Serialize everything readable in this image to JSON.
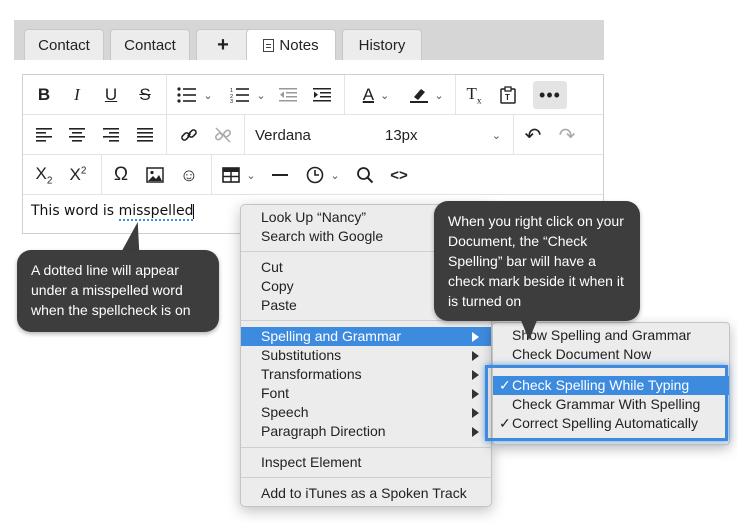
{
  "tabs": [
    {
      "label": "Contact"
    },
    {
      "label": "Contact"
    },
    {
      "label": "+"
    },
    {
      "label": "Notes"
    },
    {
      "label": "History"
    }
  ],
  "toolbar": {
    "row1": [
      "bold-icon",
      "italic-icon",
      "underline-icon",
      "strikethrough-icon",
      "bullet-list-icon",
      "numbered-list-icon",
      "outdent-icon",
      "indent-icon",
      "font-color-icon",
      "highlight-color-icon",
      "clear-format-icon",
      "paste-text-icon",
      "more-icon"
    ],
    "font_family": "Verdana",
    "font_size": "13px",
    "row3": [
      "subscript-icon",
      "superscript-icon",
      "omega-icon",
      "image-icon",
      "emoji-icon",
      "table-icon",
      "horizontal-rule-icon",
      "clock-icon",
      "search-icon",
      "code-icon"
    ]
  },
  "document": {
    "text_prefix": "This word is ",
    "misspelled_word": "misspelled"
  },
  "callouts": {
    "left": "A dotted line will appear under a misspelled word when the spellcheck is on",
    "right": "When you right click on your Document, the “Check Spelling” bar will have a check mark beside it when it is turned on"
  },
  "context_menu": {
    "look_up": "Look Up “Nancy”",
    "search_google": "Search with Google",
    "cut": "Cut",
    "copy": "Copy",
    "paste": "Paste",
    "spelling_grammar": "Spelling and Grammar",
    "substitutions": "Substitutions",
    "transformations": "Transformations",
    "font": "Font",
    "speech": "Speech",
    "paragraph_direction": "Paragraph Direction",
    "inspect_element": "Inspect Element",
    "add_itunes": "Add to iTunes as a Spoken Track"
  },
  "submenu": {
    "show_spelling": "Show Spelling and Grammar",
    "check_now": "Check Document Now",
    "check_while_typing": "Check Spelling While Typing",
    "check_grammar": "Check Grammar With Spelling",
    "correct_auto": "Correct Spelling Automatically",
    "check_mark": "✓"
  },
  "colors": {
    "highlight": "#3d8bdf",
    "callout_bg": "#3d3d3d"
  }
}
